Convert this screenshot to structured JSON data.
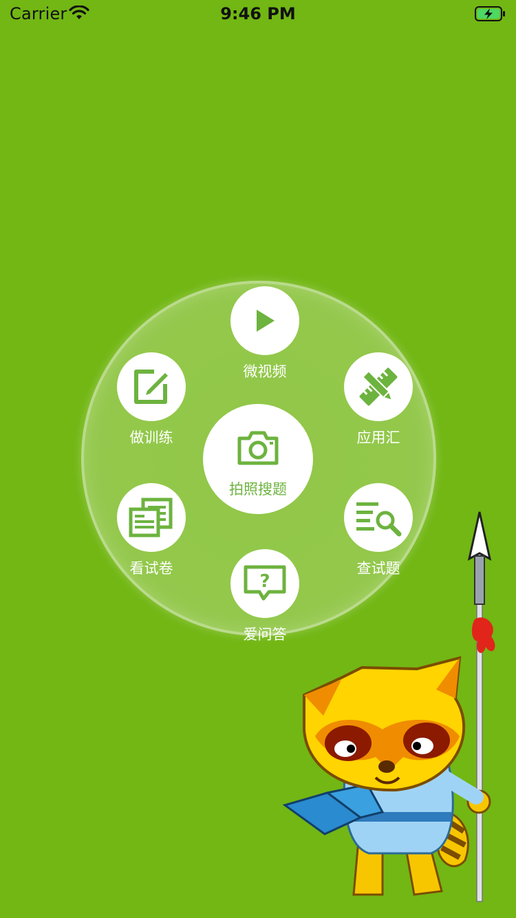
{
  "status_bar": {
    "carrier": "Carrier",
    "time": "9:46 PM",
    "wifi_icon": "wifi-icon",
    "battery_icon": "battery-charging-icon"
  },
  "menu": {
    "center": {
      "label": "拍照搜题",
      "icon": "camera-icon"
    },
    "items": [
      {
        "label": "微视频",
        "icon": "play-icon"
      },
      {
        "label": "应用汇",
        "icon": "ruler-pencil-icon"
      },
      {
        "label": "查试题",
        "icon": "search-list-icon"
      },
      {
        "label": "爱问答",
        "icon": "question-bubble-icon"
      },
      {
        "label": "看试卷",
        "icon": "papers-icon"
      },
      {
        "label": "做训练",
        "icon": "edit-icon"
      }
    ]
  },
  "colors": {
    "background": "#72b714",
    "icon_green": "#6db33f",
    "white": "#ffffff"
  },
  "mascot": {
    "icon": "raccoon-mascot-illustration"
  }
}
